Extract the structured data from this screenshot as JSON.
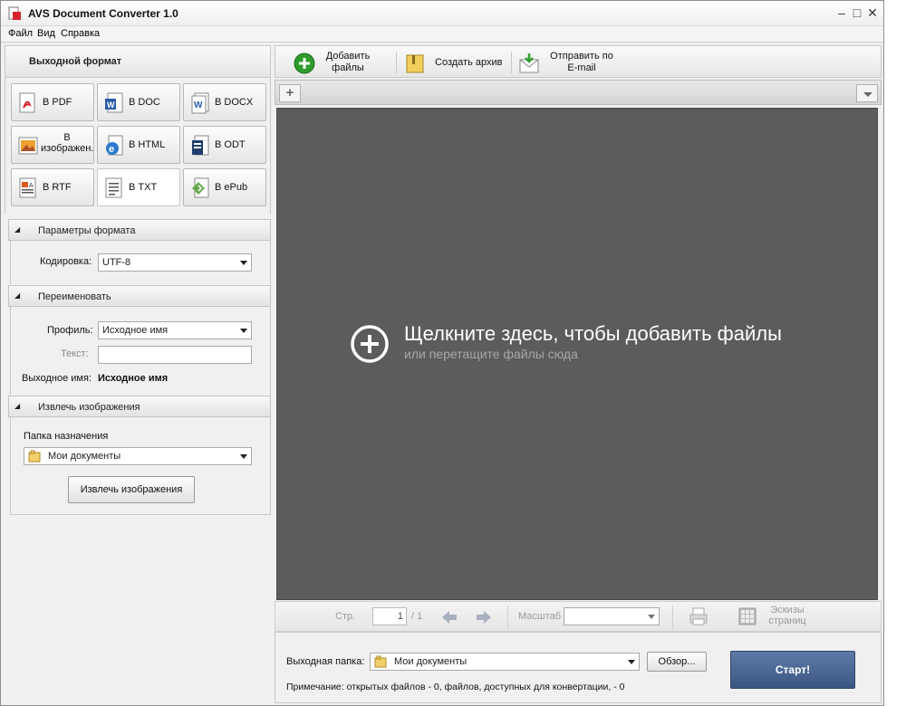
{
  "window": {
    "title": "AVS Document Converter 1.0"
  },
  "menu": [
    "Файл",
    "Вид",
    "Справка"
  ],
  "left": {
    "header": "Выходной формат",
    "formats": [
      {
        "label": "В PDF",
        "icon": "pdf-icon"
      },
      {
        "label": "В DOC",
        "icon": "doc-icon"
      },
      {
        "label": "В DOCX",
        "icon": "docx-icon"
      },
      {
        "label": "В изображен.",
        "icon": "image-icon"
      },
      {
        "label": "В HTML",
        "icon": "html-icon"
      },
      {
        "label": "В ODT",
        "icon": "odt-icon"
      },
      {
        "label": "В RTF",
        "icon": "rtf-icon"
      },
      {
        "label": "В TXT",
        "icon": "txt-icon",
        "selected": true
      },
      {
        "label": "В ePub",
        "icon": "epub-icon"
      }
    ],
    "format_params": {
      "title": "Параметры формата",
      "encoding_label": "Кодировка:",
      "encoding_value": "UTF-8"
    },
    "rename": {
      "title": "Переименовать",
      "profile_label": "Профиль:",
      "profile_value": "Исходное имя",
      "text_label": "Текст:",
      "text_value": "",
      "output_name_label": "Выходное имя:",
      "output_name_value": "Исходное имя"
    },
    "extract": {
      "title": "Извлечь изображения",
      "folder_label": "Папка назначения",
      "folder_value": "Мои документы",
      "button": "Извлечь изображения"
    }
  },
  "toolbar": {
    "add_files": "Добавить файлы",
    "create_archive": "Создать архив",
    "send_email": "Отправить по E-mail"
  },
  "dropzone": {
    "main": "Щелкните здесь, чтобы добавить файлы",
    "sub": "или перетащите файлы сюда"
  },
  "nav": {
    "page_label": "Стр.",
    "page_value": "1",
    "page_total": "/ 1",
    "zoom_label": "Масштаб",
    "zoom_value": "",
    "thumbnails": "Эскизы страниц"
  },
  "bottom": {
    "output_folder_label": "Выходная папка:",
    "output_folder_value": "Мои документы",
    "browse": "Обзор...",
    "note": "Примечание: открытых файлов - 0, файлов, доступных для конвертации, - 0",
    "start": "Старт!"
  },
  "colors": {
    "drop_bg": "#5c5c5c",
    "start_btn": "#4a6592",
    "add_green": "#2e9d2e"
  }
}
